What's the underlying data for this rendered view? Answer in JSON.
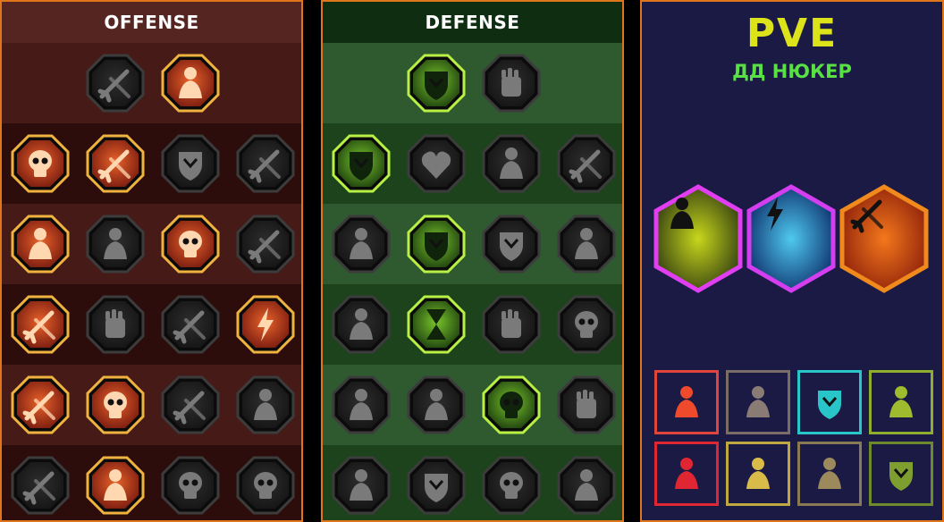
{
  "offense": {
    "title": "OFFENSE",
    "rows": [
      [
        "crossed-swords-icon",
        "claw-slash-icon"
      ],
      [
        "demon-warrior-icon",
        "spear-rain-icon",
        "armor-shield-icon",
        "heart-dagger-icon"
      ],
      [
        "pierced-warrior-icon",
        "fangs-icon",
        "skull-slash-icon",
        "scythe-hand-icon"
      ],
      [
        "bleeding-sword-icon",
        "crushing-fist-icon",
        "axe-icon",
        "lightning-chain-icon"
      ],
      [
        "sword-impact-icon",
        "triple-skull-icon",
        "dagger-ring-icon",
        "screaming-warrior-icon"
      ],
      [
        "sparkle-sword-icon",
        "flaming-helmet-icon",
        "horned-beast-icon",
        "skull-totem-icon"
      ]
    ],
    "active": [
      [
        false,
        true
      ],
      [
        true,
        true,
        false,
        false
      ],
      [
        true,
        false,
        true,
        false
      ],
      [
        true,
        false,
        false,
        true
      ],
      [
        true,
        true,
        false,
        false
      ],
      [
        false,
        true,
        false,
        false
      ]
    ]
  },
  "defense": {
    "title": "DEFENSE",
    "rows": [
      [
        "armor-scales-icon",
        "raised-fist-icon"
      ],
      [
        "chevron-shield-icon",
        "heart-organ-icon",
        "stone-golem-icon",
        "crossed-blades-icon"
      ],
      [
        "archer-icon",
        "knight-shield-icon",
        "heart-shield-icon",
        "hooded-monk-icon"
      ],
      [
        "crowd-icon",
        "hourglass-icon",
        "open-palm-icon",
        "bull-head-icon"
      ],
      [
        "dash-runner-icon",
        "triple-spike-icon",
        "radiant-skull-icon",
        "grab-hand-icon"
      ],
      [
        "spiked-warrior-icon",
        "winged-shield-icon",
        "dark-lord-icon",
        "bodybuilder-icon"
      ]
    ],
    "active": [
      [
        true,
        false
      ],
      [
        true,
        false,
        false,
        false
      ],
      [
        false,
        true,
        false,
        false
      ],
      [
        false,
        true,
        false,
        false
      ],
      [
        false,
        false,
        true,
        false
      ],
      [
        false,
        false,
        false,
        false
      ]
    ]
  },
  "pve": {
    "title": "PVE",
    "subtitle": "ДД НЮКЕР",
    "hexes": [
      {
        "icon": "justice-scales-icon",
        "border": "#e03ef0",
        "c1": "#c8d71c",
        "c2": "#2c3810"
      },
      {
        "icon": "lightning-hammer-icon",
        "border": "#d43ef0",
        "c1": "#4fc9f0",
        "c2": "#0b2a66"
      },
      {
        "icon": "flame-axe-icon",
        "border": "#f08a1c",
        "c1": "#f4781c",
        "c2": "#8a1d0a"
      }
    ],
    "squares": [
      {
        "icon": "wolf-icon",
        "border": "#e0443a",
        "color": "#ef4a2c"
      },
      {
        "icon": "compass-star-icon",
        "border": "#7a6c66",
        "color": "#8a7c74"
      },
      {
        "icon": "cross-shield-icon",
        "border": "#28c6c8",
        "color": "#28c6c8"
      },
      {
        "icon": "serpent-icon",
        "border": "#8fae2e",
        "color": "#9fbb2e"
      },
      {
        "icon": "claw-marks-icon",
        "border": "#e02632",
        "color": "#e02632"
      },
      {
        "icon": "radiant-angel-icon",
        "border": "#c0a840",
        "color": "#d8bb48"
      },
      {
        "icon": "star-burst-icon",
        "border": "#8a7a54",
        "color": "#9c8a5c"
      },
      {
        "icon": "shield-banner-icon",
        "border": "#6f8a2c",
        "color": "#7f9e30"
      }
    ]
  }
}
